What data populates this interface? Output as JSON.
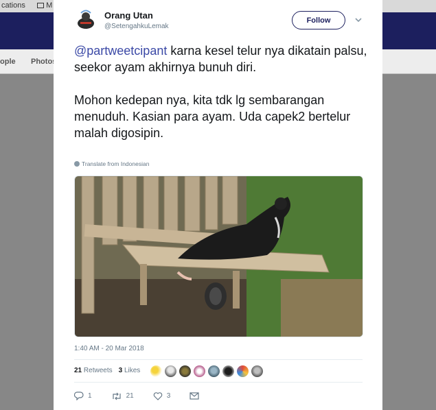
{
  "background": {
    "topbar_left": "cations",
    "topbar_mail": "M",
    "tabs": [
      "ople",
      "Photos"
    ]
  },
  "tweet": {
    "author_name": "Orang Utan",
    "author_handle": "@SetengahkuLemak",
    "follow_label": "Follow",
    "mention": "@partweetcipant",
    "text_line1_rest": " karna kesel telur nya dikatain palsu, seekor ayam akhirnya bunuh diri.",
    "text_para2": "Mohon kedepan nya, kita tdk lg sembarangan menuduh. Kasian para ayam. Uda capek2 bertelur malah digosipin.",
    "translate_label": "Translate from Indonesian",
    "timestamp": "1:40 AM - 20 Mar 2018",
    "retweets_count": "21",
    "retweets_label": "Retweets",
    "likes_count": "3",
    "likes_label": "Likes",
    "reply_count": "1",
    "retweet_action_count": "21",
    "like_action_count": "3"
  },
  "icons": {
    "reply": "reply-icon",
    "retweet": "retweet-icon",
    "like": "heart-icon",
    "dm": "envelope-icon",
    "chevron": "chevron-down-icon",
    "globe": "globe-icon"
  },
  "colors": {
    "brand": "#1c1f5e",
    "mention": "#3b49a6",
    "muted": "#657786"
  }
}
